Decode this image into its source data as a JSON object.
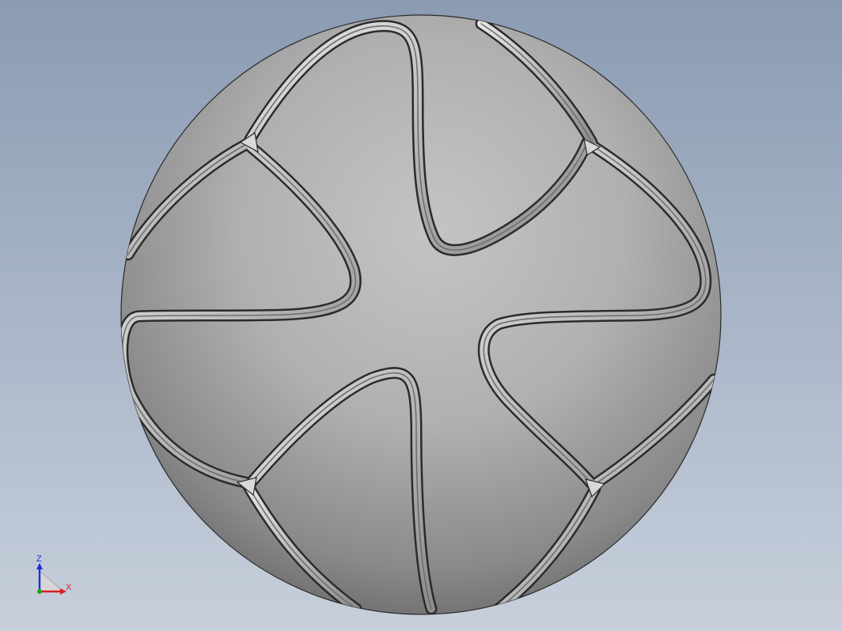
{
  "viewport": {
    "model": "ball-model"
  },
  "triad": {
    "z_label": "Z",
    "x_label": "X",
    "colors": {
      "z_axis": "#1a2fd6",
      "x_axis": "#d62020",
      "origin": "#1aa81a"
    }
  },
  "colors": {
    "background_top": "#8a9bb2",
    "background_bottom": "#c7cfdb",
    "ball_light": "#c2c2c2",
    "ball_dark": "#5e5e5e",
    "seam_edge": "#1f1f1f"
  }
}
